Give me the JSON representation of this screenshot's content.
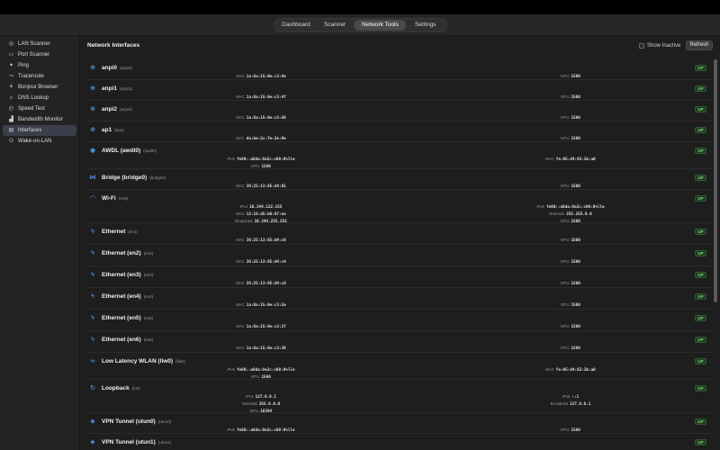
{
  "tabs": [
    {
      "label": "Dashboard",
      "active": false
    },
    {
      "label": "Scanner",
      "active": false
    },
    {
      "label": "Network Tools",
      "active": true
    },
    {
      "label": "Settings",
      "active": false
    }
  ],
  "sidebar": {
    "items": [
      {
        "label": "LAN Scanner",
        "icon": "radar-icon",
        "glyph": "◎",
        "active": false
      },
      {
        "label": "Port Scanner",
        "icon": "port-icon",
        "glyph": "▭",
        "active": false
      },
      {
        "label": "Ping",
        "icon": "ping-icon",
        "glyph": "✦",
        "active": false
      },
      {
        "label": "Traceroute",
        "icon": "route-icon",
        "glyph": "⤳",
        "active": false
      },
      {
        "label": "Bonjour Browser",
        "icon": "bonjour-icon",
        "glyph": "⚘",
        "active": false
      },
      {
        "label": "DNS Lookup",
        "icon": "magnifier-icon",
        "glyph": "⌕",
        "active": false
      },
      {
        "label": "Speed Test",
        "icon": "gauge-icon",
        "glyph": "◴",
        "active": false
      },
      {
        "label": "Bandwidth Monitor",
        "icon": "chart-icon",
        "glyph": "▟",
        "active": false
      },
      {
        "label": "Interfaces",
        "icon": "interfaces-icon",
        "glyph": "▤",
        "active": true
      },
      {
        "label": "Wake-on-LAN",
        "icon": "power-icon",
        "glyph": "⏻",
        "active": false
      }
    ]
  },
  "header": {
    "title": "Network Interfaces",
    "show_inactive_label": "Show Inactive",
    "refresh_label": "Refresh"
  },
  "colors": {
    "accent": "#5aa9ff",
    "up_badge": "#7ed37f"
  },
  "interfaces": [
    {
      "name": "anpi0",
      "dev": "(anpi0)",
      "status": "UP",
      "icon": "globe-icon",
      "glyph": "⊕",
      "height": 23,
      "left": [
        {
          "k": "MAC",
          "v": "1a:6a:15:0e:c3:4e"
        }
      ],
      "right": [
        {
          "k": "MTU",
          "v": "1500"
        }
      ]
    },
    {
      "name": "anpi1",
      "dev": "(anpi1)",
      "status": "UP",
      "icon": "globe-icon",
      "glyph": "⊕",
      "height": 23,
      "left": [
        {
          "k": "MAC",
          "v": "1a:6a:15:0e:c3:4f"
        }
      ],
      "right": [
        {
          "k": "MTU",
          "v": "1500"
        }
      ]
    },
    {
      "name": "anpi2",
      "dev": "(anpi2)",
      "status": "UP",
      "icon": "globe-icon",
      "glyph": "⊕",
      "height": 23,
      "left": [
        {
          "k": "MAC",
          "v": "1a:6a:15:0e:c3:50"
        }
      ],
      "right": [
        {
          "k": "MTU",
          "v": "1500"
        }
      ]
    },
    {
      "name": "ap1",
      "dev": "(ap1)",
      "status": "UP",
      "icon": "globe-icon",
      "glyph": "⊕",
      "height": 23,
      "left": [
        {
          "k": "MAC",
          "v": "da:be:2c:7e:2e:9e"
        }
      ],
      "right": [
        {
          "k": "MTU",
          "v": "1500"
        }
      ]
    },
    {
      "name": "AWDL (awdl0)",
      "dev": "(awdl0)",
      "status": "UP",
      "icon": "awdl-icon",
      "glyph": "◉",
      "height": 30,
      "left": [
        {
          "k": "IPv6",
          "v": "fe80::a8da:8e2c:c08:0%lle"
        },
        {
          "k": "MTU",
          "v": "1500"
        }
      ],
      "right": [
        {
          "k": "MAC",
          "v": "fe:05:d4:62:2b:a0"
        }
      ]
    },
    {
      "name": "Bridge (bridge0)",
      "dev": "(bridge0)",
      "status": "UP",
      "icon": "bridge-icon",
      "glyph": "⋈",
      "height": 23,
      "left": [
        {
          "k": "MAC",
          "v": "36:25:13:65:d4:01"
        }
      ],
      "right": [
        {
          "k": "MTU",
          "v": "1500"
        }
      ]
    },
    {
      "name": "Wi-Fi",
      "dev": "(en0)",
      "status": "UP",
      "icon": "wifi-icon",
      "glyph": "◠",
      "height": 37,
      "left": [
        {
          "k": "IPv4",
          "v": "10.244.122.155"
        },
        {
          "k": "MAC",
          "v": "12:16:d5:b6:07:ea"
        },
        {
          "k": "Broadcast",
          "v": "10.244.255.255"
        }
      ],
      "right": [
        {
          "k": "IPv6",
          "v": "fe80::a8da:8e2c:c00:0%lle"
        },
        {
          "k": "Netmask",
          "v": "255.255.0.0"
        },
        {
          "k": "MTU",
          "v": "1500"
        }
      ]
    },
    {
      "name": "Ethernet",
      "dev": "(en1)",
      "status": "UP",
      "icon": "bolt-icon",
      "glyph": "ϟ",
      "height": 24,
      "left": [
        {
          "k": "MAC",
          "v": "36:25:13:65:d4:c0"
        }
      ],
      "right": [
        {
          "k": "MTU",
          "v": "1500"
        }
      ]
    },
    {
      "name": "Ethernet (en2)",
      "dev": "(en2)",
      "status": "UP",
      "icon": "bolt-icon",
      "glyph": "ϟ",
      "height": 24,
      "left": [
        {
          "k": "MAC",
          "v": "36:25:13:65:d4:c4"
        }
      ],
      "right": [
        {
          "k": "MTU",
          "v": "1500"
        }
      ]
    },
    {
      "name": "Ethernet (en3)",
      "dev": "(en3)",
      "status": "UP",
      "icon": "bolt-icon",
      "glyph": "ϟ",
      "height": 24,
      "left": [
        {
          "k": "MAC",
          "v": "36:25:13:65:d4:c8"
        }
      ],
      "right": [
        {
          "k": "MTU",
          "v": "1500"
        }
      ]
    },
    {
      "name": "Ethernet (en4)",
      "dev": "(en4)",
      "status": "UP",
      "icon": "bolt-icon",
      "glyph": "ϟ",
      "height": 24,
      "left": [
        {
          "k": "MAC",
          "v": "1a:6a:15:0e:c3:2e"
        }
      ],
      "right": [
        {
          "k": "MTU",
          "v": "1500"
        }
      ]
    },
    {
      "name": "Ethernet (en5)",
      "dev": "(en5)",
      "status": "UP",
      "icon": "bolt-icon",
      "glyph": "ϟ",
      "height": 24,
      "left": [
        {
          "k": "MAC",
          "v": "1a:6a:15:0e:c3:2f"
        }
      ],
      "right": [
        {
          "k": "MTU",
          "v": "1500"
        }
      ]
    },
    {
      "name": "Ethernet (en6)",
      "dev": "(en6)",
      "status": "UP",
      "icon": "bolt-icon",
      "glyph": "ϟ",
      "height": 24,
      "left": [
        {
          "k": "MAC",
          "v": "1a:6a:15:0e:c3:30"
        }
      ],
      "right": [
        {
          "k": "MTU",
          "v": "1500"
        }
      ]
    },
    {
      "name": "Low Latency WLAN (llw0)",
      "dev": "(llw0)",
      "status": "UP",
      "icon": "link-icon",
      "glyph": "∞",
      "height": 30,
      "left": [
        {
          "k": "IPv6",
          "v": "fe80::a8da:8e2c:c08:0%lle"
        },
        {
          "k": "MTU",
          "v": "1500"
        }
      ],
      "right": [
        {
          "k": "MAC",
          "v": "fe:05:d4:62:2b:a0"
        }
      ]
    },
    {
      "name": "Loopback",
      "dev": "(lo0)",
      "status": "UP",
      "icon": "loop-icon",
      "glyph": "↻",
      "height": 37,
      "left": [
        {
          "k": "IPv4",
          "v": "127.0.0.1"
        },
        {
          "k": "Netmask",
          "v": "255.0.0.0"
        },
        {
          "k": "MTU",
          "v": "16384"
        }
      ],
      "right": [
        {
          "k": "IPv6",
          "v": "::1"
        },
        {
          "k": "Broadcast",
          "v": "127.0.0.1"
        }
      ]
    },
    {
      "name": "VPN Tunnel (utun0)",
      "dev": "(utun0)",
      "status": "UP",
      "icon": "vpn-icon",
      "glyph": "◈",
      "height": 23,
      "left": [
        {
          "k": "IPv6",
          "v": "fe80::a8da:8e2c:c08:0%lle"
        }
      ],
      "right": [
        {
          "k": "MTU",
          "v": "1500"
        }
      ]
    },
    {
      "name": "VPN Tunnel (utun1)",
      "dev": "(utun1)",
      "status": "UP",
      "icon": "vpn-icon",
      "glyph": "◈",
      "height": 23,
      "left": [],
      "right": []
    }
  ]
}
